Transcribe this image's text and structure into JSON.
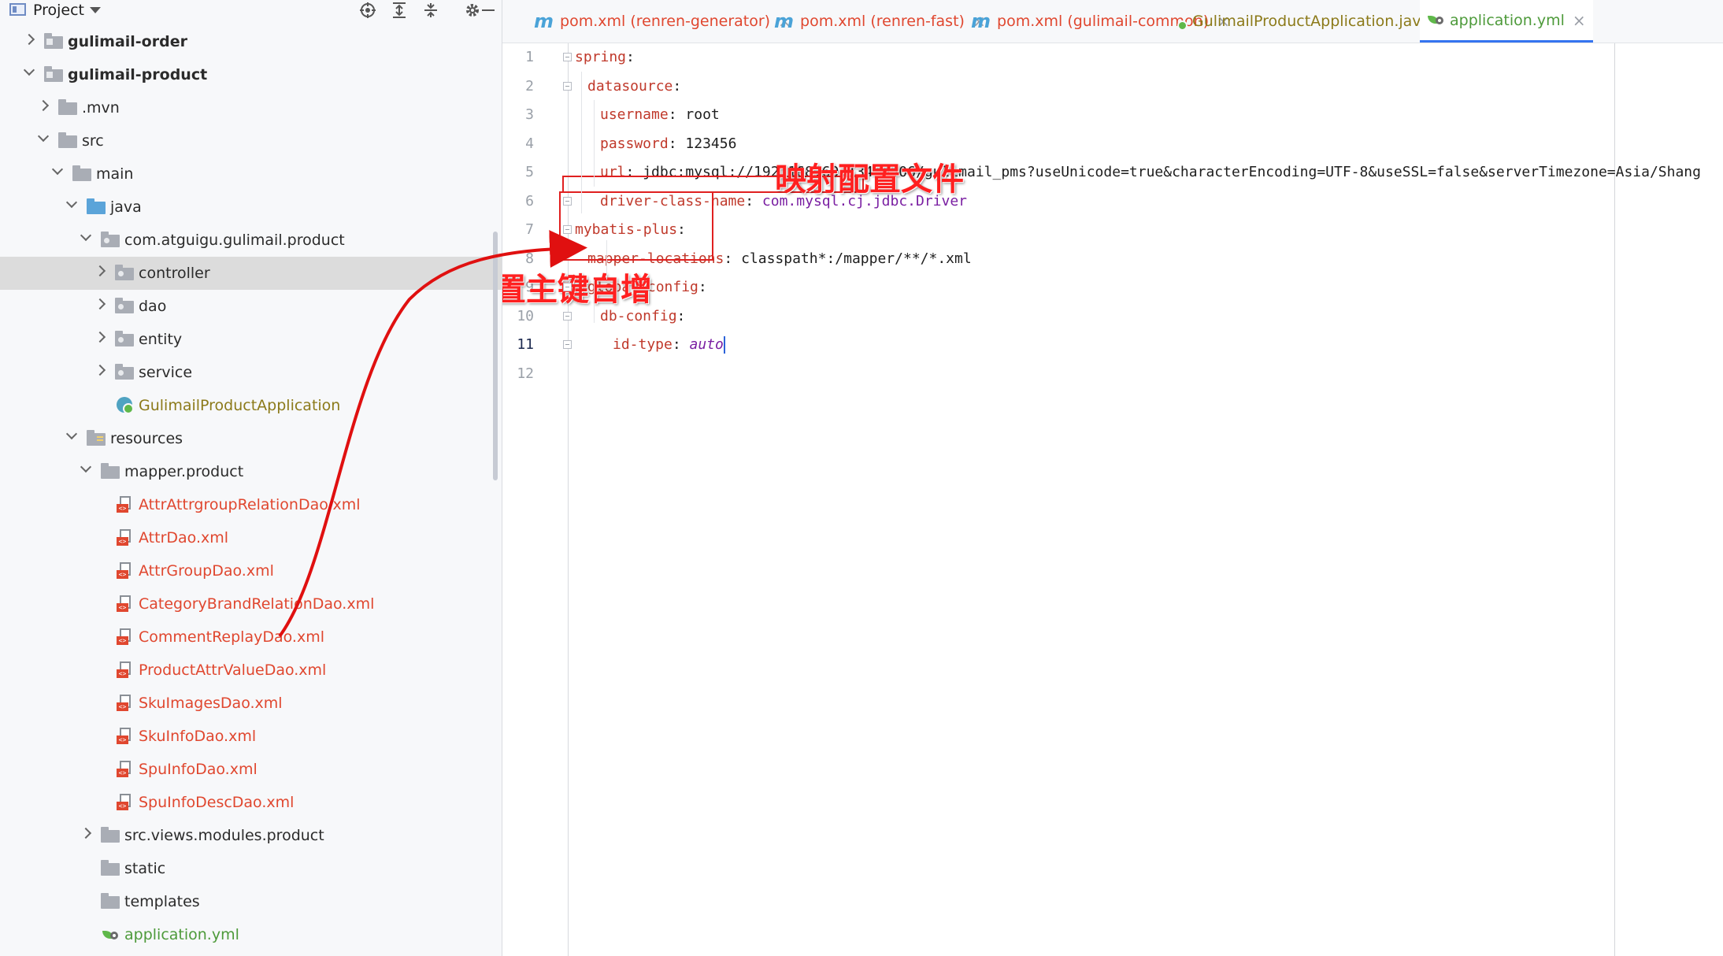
{
  "project_panel": {
    "title": "Project",
    "tree": [
      {
        "label": "gulimail-order",
        "icon": "module-folder-icon",
        "depth": 0,
        "chevron": "collapsed",
        "style": "bold"
      },
      {
        "label": "gulimail-product",
        "icon": "module-folder-icon",
        "depth": 0,
        "chevron": "expanded",
        "style": "bold"
      },
      {
        "label": ".mvn",
        "icon": "folder-icon",
        "depth": 1,
        "chevron": "collapsed",
        "style": "normal"
      },
      {
        "label": "src",
        "icon": "folder-icon",
        "depth": 1,
        "chevron": "expanded",
        "style": "normal"
      },
      {
        "label": "main",
        "icon": "folder-icon",
        "depth": 2,
        "chevron": "expanded",
        "style": "normal"
      },
      {
        "label": "java",
        "icon": "source-folder-icon",
        "depth": 3,
        "chevron": "expanded",
        "style": "normal"
      },
      {
        "label": "com.atguigu.gulimail.product",
        "icon": "package-icon",
        "depth": 4,
        "chevron": "expanded",
        "style": "normal"
      },
      {
        "label": "controller",
        "icon": "package-icon",
        "depth": 5,
        "chevron": "collapsed",
        "style": "normal",
        "selected": true
      },
      {
        "label": "dao",
        "icon": "package-icon",
        "depth": 5,
        "chevron": "collapsed",
        "style": "normal"
      },
      {
        "label": "entity",
        "icon": "package-icon",
        "depth": 5,
        "chevron": "collapsed",
        "style": "normal"
      },
      {
        "label": "service",
        "icon": "package-icon",
        "depth": 5,
        "chevron": "collapsed",
        "style": "normal"
      },
      {
        "label": "GulimailProductApplication",
        "icon": "spring-class-icon",
        "depth": 5,
        "chevron": "none",
        "style": "app"
      },
      {
        "label": "resources",
        "icon": "resources-folder-icon",
        "depth": 3,
        "chevron": "expanded",
        "style": "normal"
      },
      {
        "label": "mapper.product",
        "icon": "folder-icon",
        "depth": 4,
        "chevron": "expanded",
        "style": "normal"
      },
      {
        "label": "AttrAttrgroupRelationDao.xml",
        "icon": "xml-file-icon",
        "depth": 5,
        "chevron": "none",
        "style": "xml"
      },
      {
        "label": "AttrDao.xml",
        "icon": "xml-file-icon",
        "depth": 5,
        "chevron": "none",
        "style": "xml"
      },
      {
        "label": "AttrGroupDao.xml",
        "icon": "xml-file-icon",
        "depth": 5,
        "chevron": "none",
        "style": "xml"
      },
      {
        "label": "CategoryBrandRelationDao.xml",
        "icon": "xml-file-icon",
        "depth": 5,
        "chevron": "none",
        "style": "xml"
      },
      {
        "label": "CommentReplayDao.xml",
        "icon": "xml-file-icon",
        "depth": 5,
        "chevron": "none",
        "style": "xml"
      },
      {
        "label": "ProductAttrValueDao.xml",
        "icon": "xml-file-icon",
        "depth": 5,
        "chevron": "none",
        "style": "xml"
      },
      {
        "label": "SkuImagesDao.xml",
        "icon": "xml-file-icon",
        "depth": 5,
        "chevron": "none",
        "style": "xml"
      },
      {
        "label": "SkuInfoDao.xml",
        "icon": "xml-file-icon",
        "depth": 5,
        "chevron": "none",
        "style": "xml"
      },
      {
        "label": "SpuInfoDao.xml",
        "icon": "xml-file-icon",
        "depth": 5,
        "chevron": "none",
        "style": "xml"
      },
      {
        "label": "SpuInfoDescDao.xml",
        "icon": "xml-file-icon",
        "depth": 5,
        "chevron": "none",
        "style": "xml"
      },
      {
        "label": "src.views.modules.product",
        "icon": "folder-icon",
        "depth": 4,
        "chevron": "collapsed",
        "style": "normal"
      },
      {
        "label": "static",
        "icon": "folder-icon",
        "depth": 4,
        "chevron": "none",
        "style": "normal"
      },
      {
        "label": "templates",
        "icon": "folder-icon",
        "depth": 4,
        "chevron": "none",
        "style": "normal"
      },
      {
        "label": "application.yml",
        "icon": "yaml-config-icon",
        "depth": 4,
        "chevron": "none",
        "style": "yml"
      }
    ]
  },
  "tabs": [
    {
      "label": "pom.xml (renren-generator)",
      "icon": "maven-icon",
      "kind": "xml"
    },
    {
      "label": "pom.xml (renren-fast)",
      "icon": "maven-icon",
      "kind": "xml"
    },
    {
      "label": "pom.xml (gulimail-common)",
      "icon": "maven-icon",
      "kind": "xml"
    },
    {
      "label": "GulimailProductApplication.java",
      "icon": "spring-class-icon",
      "kind": "java"
    },
    {
      "label": "application.yml",
      "icon": "yaml-config-icon",
      "kind": "yml",
      "active": true
    }
  ],
  "tab_maven_glyph": "m",
  "editor": {
    "current_line": 11,
    "lines": [
      {
        "n": 1,
        "indent": 0,
        "key": "spring",
        "value": ""
      },
      {
        "n": 2,
        "indent": 1,
        "key": "datasource",
        "value": ""
      },
      {
        "n": 3,
        "indent": 2,
        "key": "username",
        "value": "root"
      },
      {
        "n": 4,
        "indent": 2,
        "key": "password",
        "value": "123456"
      },
      {
        "n": 5,
        "indent": 2,
        "key": "url",
        "value": "jdbc:mysql://192.168.60.134:3306/gulimail_pms?useUnicode=true&characterEncoding=UTF-8&useSSL=false&serverTimezone=Asia/Shang"
      },
      {
        "n": 6,
        "indent": 2,
        "key": "driver-class-name",
        "value": "com.mysql.cj.jdbc.Driver",
        "value_style": "class"
      },
      {
        "n": 7,
        "indent": 0,
        "key": "mybatis-plus",
        "value": ""
      },
      {
        "n": 8,
        "indent": 1,
        "key": "mapper-locations",
        "value": "classpath*:/mapper/**/*.xml"
      },
      {
        "n": 9,
        "indent": 1,
        "key": "global-config",
        "value": ""
      },
      {
        "n": 10,
        "indent": 2,
        "key": "db-config",
        "value": ""
      },
      {
        "n": 11,
        "indent": 3,
        "key": "id-type",
        "value": "auto",
        "value_style": "italic"
      },
      {
        "n": 12,
        "indent": 0,
        "key": "",
        "value": ""
      }
    ]
  },
  "annotations": {
    "mapper_note": "映射配置文件",
    "id_note": "配置主键自增"
  },
  "colors": {
    "annotation_red": "#ff2020",
    "yaml_key": "#c0392b",
    "active_tab_underline": "#3574f0",
    "xml_file_text": "#e0472f"
  }
}
